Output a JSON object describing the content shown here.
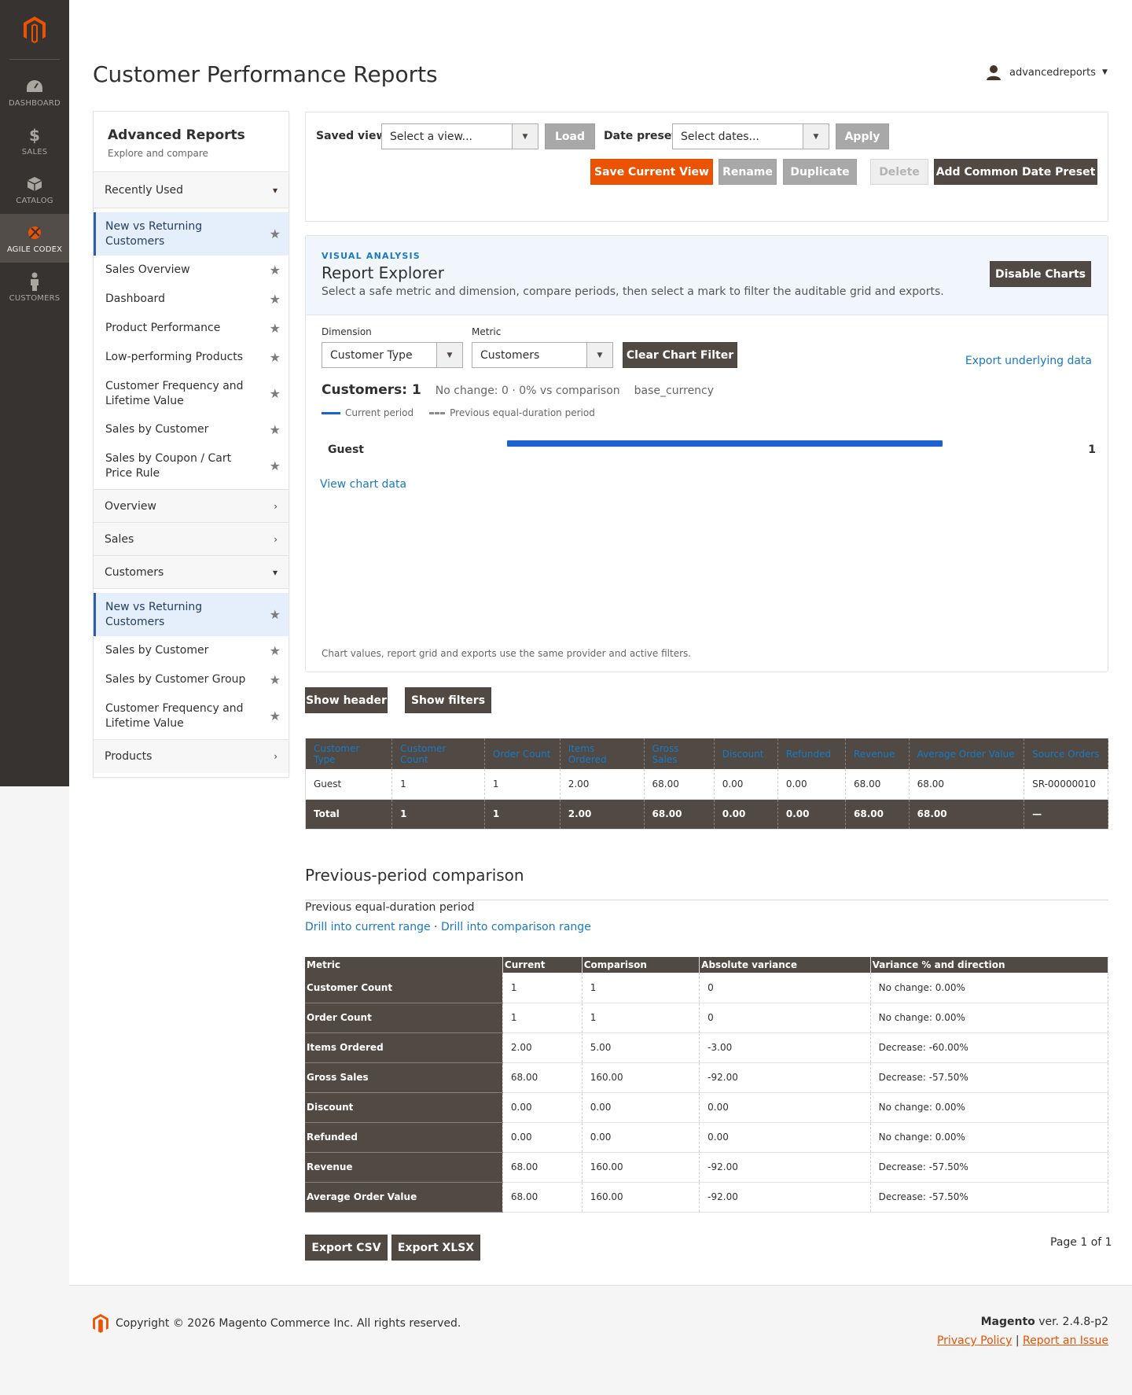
{
  "nav": {
    "items": [
      {
        "label": "DASHBOARD",
        "icon": "dashboard-icon"
      },
      {
        "label": "SALES",
        "icon": "dollar-icon"
      },
      {
        "label": "CATALOG",
        "icon": "box-icon"
      },
      {
        "label": "AGILE CODEX",
        "icon": "codex-icon"
      },
      {
        "label": "CUSTOMERS",
        "icon": "person-icon"
      }
    ]
  },
  "page": {
    "title": "Customer Performance Reports"
  },
  "user": {
    "name": "advancedreports"
  },
  "sidebar": {
    "title": "Advanced Reports",
    "subtitle": "Explore and compare",
    "recently_used": "Recently Used",
    "recent_items": [
      "New vs Returning Customers",
      "Sales Overview",
      "Dashboard",
      "Product Performance",
      "Low-performing Products",
      "Customer Frequency and Lifetime Value",
      "Sales by Customer",
      "Sales by Coupon / Cart Price Rule"
    ],
    "overview": "Overview",
    "sales": "Sales",
    "customers": "Customers",
    "customer_items": [
      "New vs Returning Customers",
      "Sales by Customer",
      "Sales by Customer Group",
      "Customer Frequency and Lifetime Value"
    ],
    "products": "Products"
  },
  "saved_view": {
    "label": "Saved view",
    "select_placeholder": "Select a view...",
    "load": "Load",
    "date_label": "Date preset",
    "date_placeholder": "Select dates...",
    "apply": "Apply",
    "save_current": "Save Current View",
    "rename": "Rename",
    "duplicate": "Duplicate",
    "delete": "Delete",
    "add_preset": "Add Common Date Preset"
  },
  "visual": {
    "kicker": "VISUAL ANALYSIS",
    "title": "Report Explorer",
    "description": "Select a safe metric and dimension, compare periods, then select a mark to filter the auditable grid and exports.",
    "disable_charts": "Disable Charts",
    "dimension_label": "Dimension",
    "dimension_value": "Customer Type",
    "metric_label": "Metric",
    "metric_value": "Customers",
    "clear_filter": "Clear Chart Filter",
    "export_link": "Export underlying data",
    "summary_main": "Customers: 1",
    "summary_change": "No change: 0 · 0% vs comparison",
    "summary_currency": "base_currency",
    "legend_current": "Current period",
    "legend_previous": "Previous equal-duration period",
    "view_chart_data": "View chart data",
    "footnote": "Chart values, report grid and exports use the same provider and active filters."
  },
  "chart_data": {
    "type": "bar",
    "categories": [
      "Guest"
    ],
    "series": [
      {
        "name": "Current period",
        "values": [
          1
        ]
      }
    ],
    "max": 1,
    "title": "",
    "xlabel": "",
    "ylabel": ""
  },
  "toggles": {
    "show_header": "Show header",
    "show_filters": "Show filters"
  },
  "grid": {
    "columns": [
      "Customer Type",
      "Customer Count",
      "Order Count",
      "Items Ordered",
      "Gross Sales",
      "Discount",
      "Refunded",
      "Revenue",
      "Average Order Value",
      "Source Orders"
    ],
    "rows": [
      [
        "Guest",
        "1",
        "1",
        "2.00",
        "68.00",
        "0.00",
        "0.00",
        "68.00",
        "68.00",
        "SR-00000010"
      ]
    ],
    "total": [
      "Total",
      "1",
      "1",
      "2.00",
      "68.00",
      "0.00",
      "0.00",
      "68.00",
      "68.00",
      "—"
    ]
  },
  "comparison": {
    "title": "Previous-period comparison",
    "subtitle": "Previous equal-duration period",
    "link_current": "Drill into current range",
    "separator": " · ",
    "link_comparison": "Drill into comparison range",
    "columns": [
      "Metric",
      "Current",
      "Comparison",
      "Absolute variance",
      "Variance % and direction"
    ],
    "rows": [
      [
        "Customer Count",
        "1",
        "1",
        "0",
        "No change: 0.00%"
      ],
      [
        "Order Count",
        "1",
        "1",
        "0",
        "No change: 0.00%"
      ],
      [
        "Items Ordered",
        "2.00",
        "5.00",
        "-3.00",
        "Decrease: -60.00%"
      ],
      [
        "Gross Sales",
        "68.00",
        "160.00",
        "-92.00",
        "Decrease: -57.50%"
      ],
      [
        "Discount",
        "0.00",
        "0.00",
        "0.00",
        "No change: 0.00%"
      ],
      [
        "Refunded",
        "0.00",
        "0.00",
        "0.00",
        "No change: 0.00%"
      ],
      [
        "Revenue",
        "68.00",
        "160.00",
        "-92.00",
        "Decrease: -57.50%"
      ],
      [
        "Average Order Value",
        "68.00",
        "160.00",
        "-92.00",
        "Decrease: -57.50%"
      ]
    ]
  },
  "export": {
    "csv": "Export CSV",
    "xlsx": "Export XLSX",
    "pager": "Page 1 of 1"
  },
  "footer": {
    "copyright": "Copyright © 2026 Magento Commerce Inc. All rights reserved.",
    "brand": "Magento",
    "version": " ver. 2.4.8-p2",
    "privacy": "Privacy Policy",
    "sep": " | ",
    "report": "Report an Issue"
  },
  "colors": {
    "accent": "#eb5202",
    "link": "#1979c3",
    "dark": "#514943",
    "bar": "#1d62d3"
  }
}
